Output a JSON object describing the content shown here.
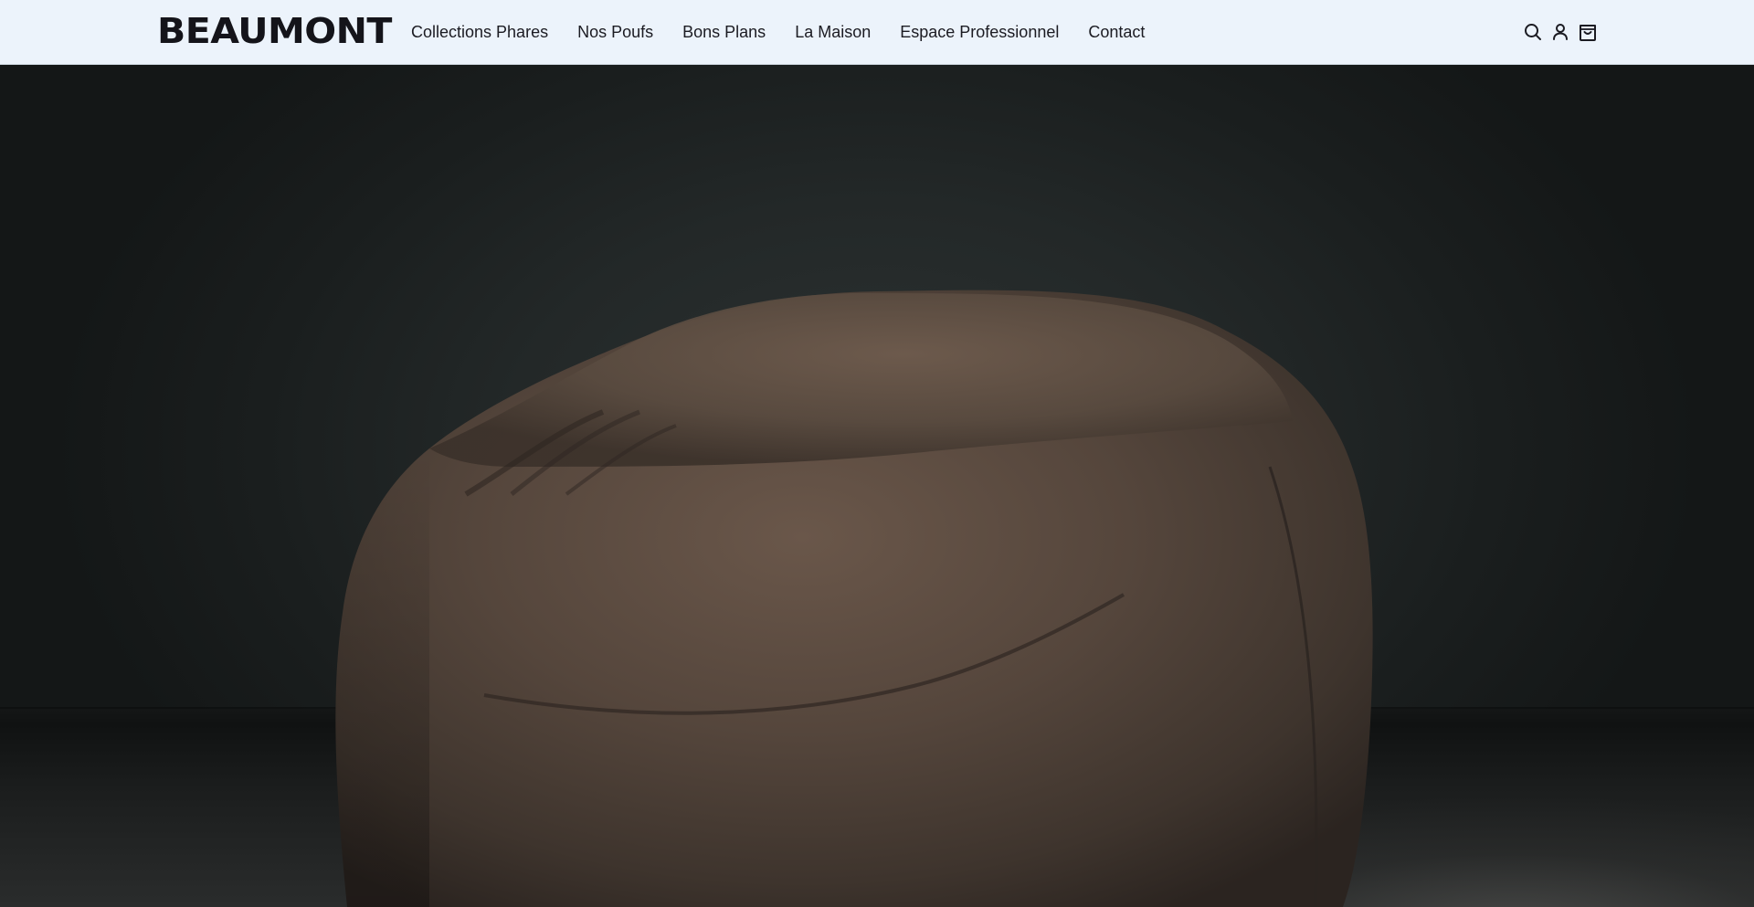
{
  "header": {
    "brand": "BEAUMONT",
    "nav": [
      {
        "label": "Collections Phares"
      },
      {
        "label": "Nos Poufs"
      },
      {
        "label": "Bons Plans"
      },
      {
        "label": "La Maison"
      },
      {
        "label": "Espace Professionnel"
      },
      {
        "label": "Contact"
      }
    ],
    "icons": [
      "search-icon",
      "account-icon",
      "cart-icon"
    ]
  },
  "hero": {
    "media": "bean-bag-pouf-video",
    "colors": {
      "background": "#1a1d1d",
      "pouf": "#5a4a3f"
    }
  },
  "colors": {
    "header_bg": "#ecf3fb",
    "text": "#1b1b22"
  }
}
